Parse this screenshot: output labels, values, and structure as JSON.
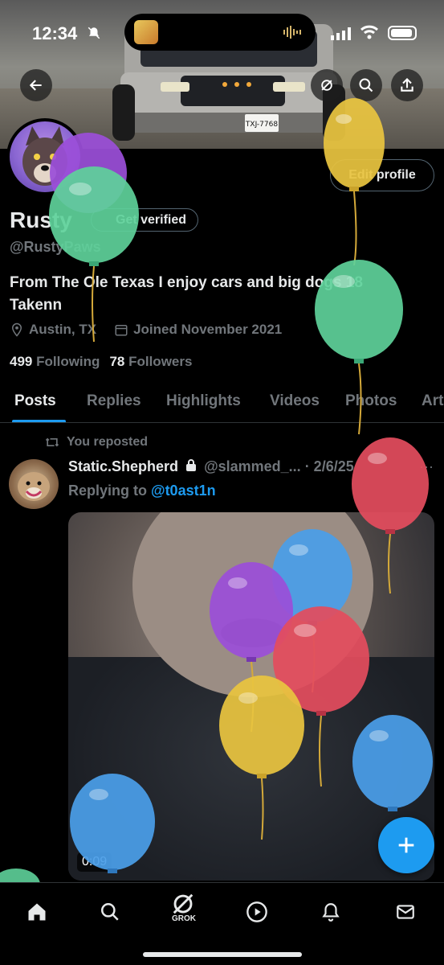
{
  "status_bar": {
    "time": "12:34"
  },
  "plate": "TXJ-7768",
  "profile": {
    "name": "Rusty",
    "get_verified": "Get verified",
    "handle": "@RustyPaws",
    "bio": "From The Ole Texas I enjoy cars and big dogs 18 Takenn",
    "location": "Austin, TX",
    "joined": "Joined November 2021",
    "following_count": "499",
    "following_label": "Following",
    "followers_count": "78",
    "followers_label": "Followers",
    "edit_profile": "Edit profile"
  },
  "tabs": [
    {
      "label": "Posts"
    },
    {
      "label": "Replies"
    },
    {
      "label": "Highlights"
    },
    {
      "label": "Videos"
    },
    {
      "label": "Photos"
    },
    {
      "label": "Articles"
    }
  ],
  "post": {
    "reposted": "You reposted",
    "username": "Static.Shepherd",
    "handle": "@slammed_...",
    "date": "· 2/6/25",
    "replying_prefix": "Replying to",
    "replying_to": "@t0ast1n",
    "duration": "0:09",
    "more": "···"
  },
  "nav": {
    "grok_label": "GROK"
  },
  "colors": {
    "accent": "#1d9bf0",
    "background": "#000000",
    "muted": "#71767b"
  },
  "icons": [
    "back-arrow-icon",
    "refresh-icon",
    "search-icon",
    "share-icon",
    "location-pin-icon",
    "calendar-icon",
    "repost-icon",
    "lock-icon",
    "plus-icon",
    "home-icon",
    "grok-icon",
    "play-icon",
    "bell-icon",
    "mail-icon"
  ]
}
